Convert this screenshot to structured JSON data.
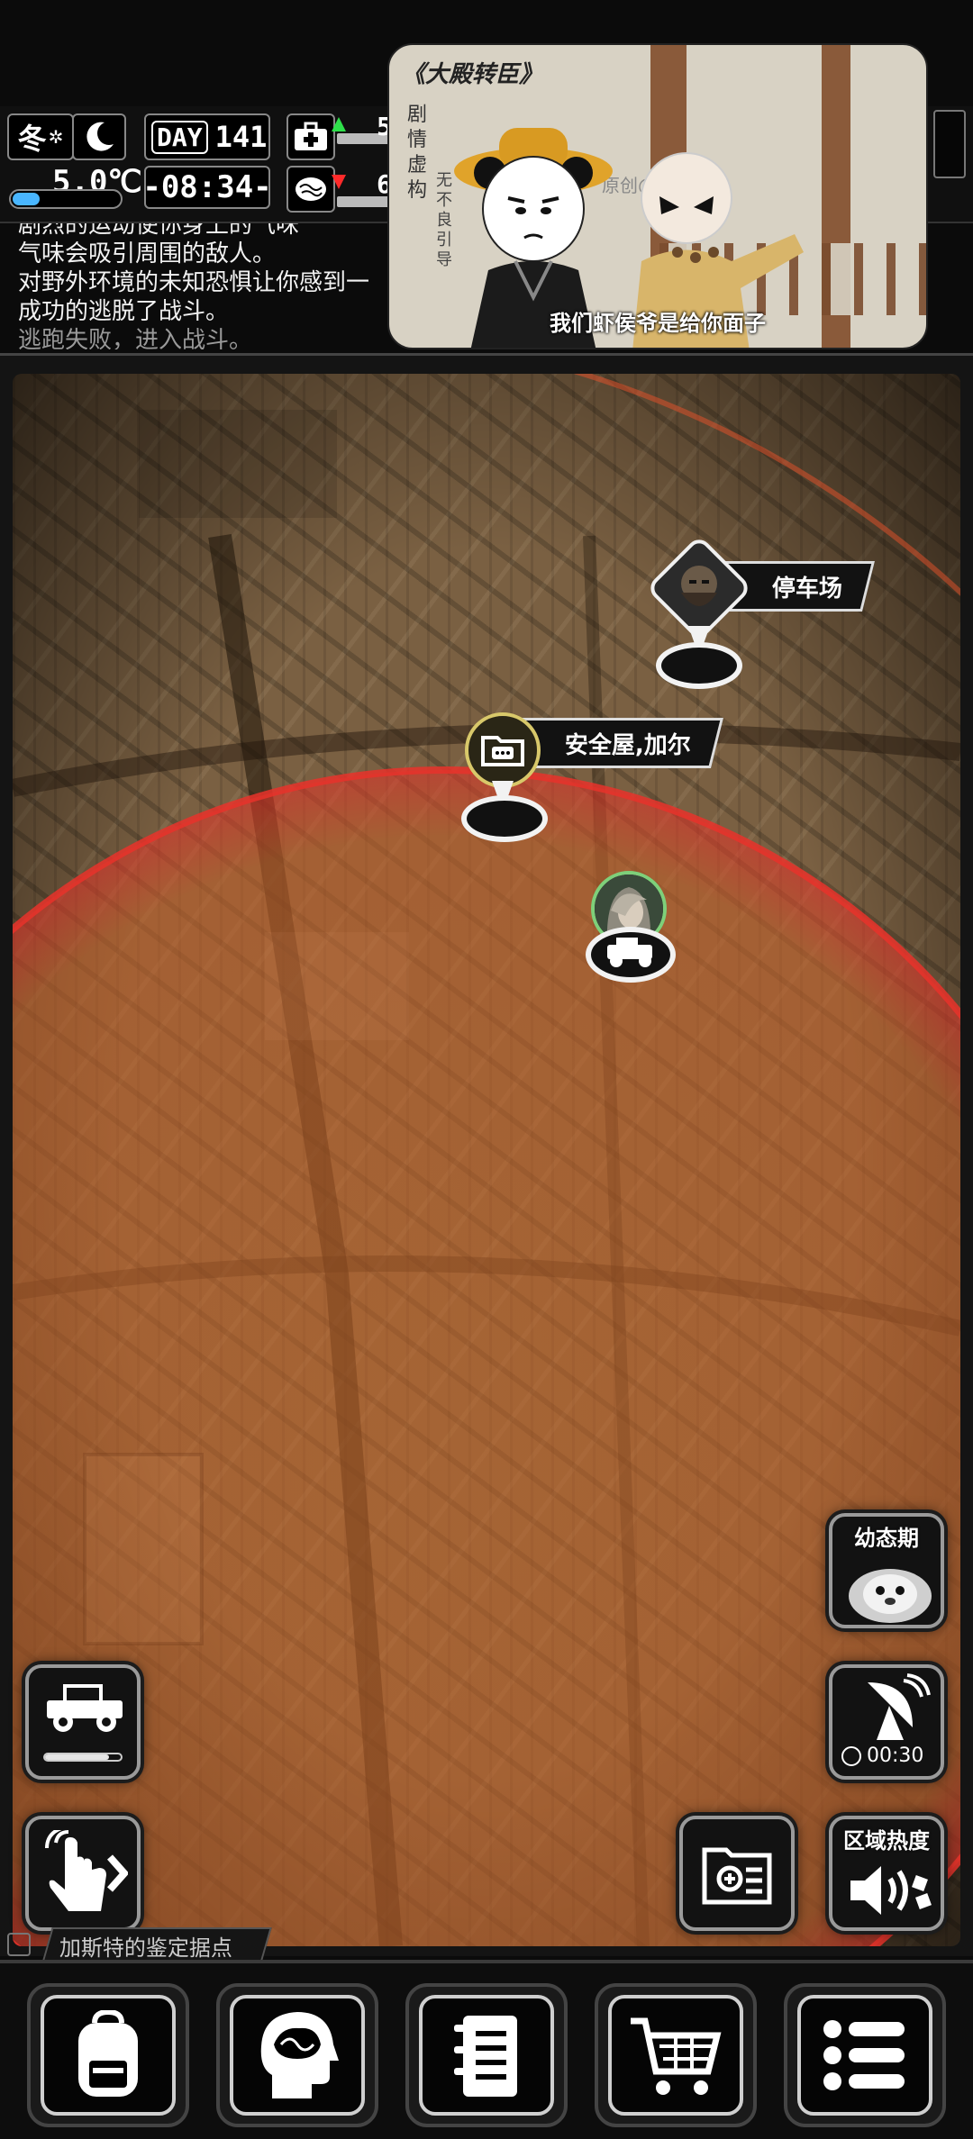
{
  "hud": {
    "season": "冬",
    "temperature": "5.0℃",
    "temperature_fill_fraction": 0.25,
    "day_label": "DAY",
    "day_number": "141",
    "clock": "-08:34-",
    "health_arrow": "up",
    "sanity_arrow": "down",
    "health_partial": "5",
    "sanity_partial": "6"
  },
  "log": {
    "lines": [
      "剧烈的运动使你身上的气味",
      "气味会吸引周围的敌人。",
      "对野外环境的未知恐惧让你感到一",
      "成功的逃脱了战斗。",
      "逃跑失败，进入战斗。"
    ]
  },
  "video": {
    "title": "《大殿转臣》",
    "vertical_text": "剧情虚构",
    "vertical_text2": "无不良引导",
    "credit": "原创@",
    "subtitle": "我们虾侯爷是给你面子"
  },
  "map": {
    "markers": [
      {
        "label": "停车场",
        "icon": "survivor-portrait-icon"
      },
      {
        "label": "安全屋,加尔",
        "icon": "chat-folder-icon"
      },
      {
        "label": "",
        "icon": "player-portrait-icon"
      }
    ]
  },
  "buttons": {
    "creature_title": "幼态期",
    "radar_timer": "00:30",
    "heat_title": "区域热度",
    "vehicle_fuel_fraction": 0.85
  },
  "location_tag": "加斯特的鉴定据点",
  "bottom_nav": [
    {
      "name": "backpack",
      "icon": "backpack-icon"
    },
    {
      "name": "skills",
      "icon": "brain-head-icon"
    },
    {
      "name": "journal",
      "icon": "notebook-icon"
    },
    {
      "name": "shop",
      "icon": "shopping-cart-icon"
    },
    {
      "name": "menu",
      "icon": "list-menu-icon"
    }
  ],
  "colors": {
    "danger_ring": "#e8322a",
    "map_tint": "#b8622a",
    "temp_bar": "#49b6ff",
    "arrow_up": "#2ee04a",
    "arrow_down": "#ff2a2a"
  }
}
